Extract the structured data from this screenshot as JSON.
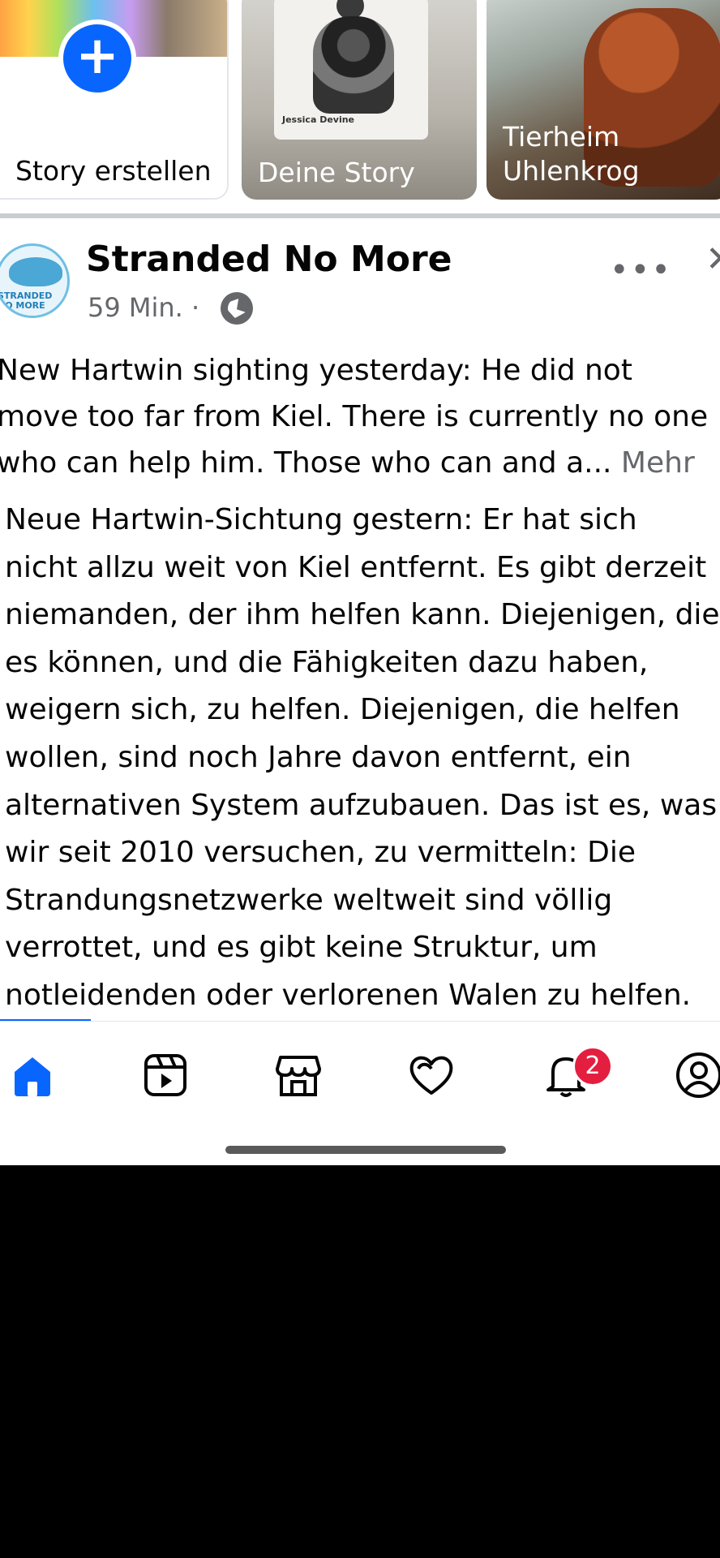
{
  "stories": {
    "create_label": "Story erstellen",
    "mine_label": "Deine Story",
    "mine_artist": "Jessica Devine",
    "shelter_label": "Tierheim Uhlenkrog"
  },
  "post": {
    "page_name": "Stranded No More",
    "avatar_text": "STRANDED NO MORE",
    "time": "59 Min. ·",
    "original_lines": [
      "New Hartwin sighting yesterday: He did not",
      "move too far from Kiel. There is currently no one",
      "who can help him. Those who can and a..."
    ],
    "more_label": "Mehr",
    "translation_lines": [
      "Neue Hartwin-Sichtung gestern: Er hat sich",
      "nicht allzu weit von Kiel entfernt. Es gibt derzeit",
      "niemanden, der ihm helfen kann. Diejenigen, die",
      "es können, und die Fähigkeiten dazu haben,",
      "weigern sich, zu helfen. Diejenigen, die helfen",
      "wollen, sind noch Jahre davon entfernt, ein",
      "alternativen System aufzubauen. Das ist es, was",
      "wir seit 2010 versuchen, zu vermitteln: Die",
      "Strandungsnetzwerke weltweit sind völlig",
      "verrottet, und es gibt keine Struktur, um",
      "notleidenden oder verlorenen Walen zu helfen."
    ]
  },
  "tabbar": {
    "notifications_badge": "2",
    "active_color": "#0866ff"
  },
  "icons": {
    "more": "more-icon",
    "close": "close-icon",
    "globe": "globe-icon"
  }
}
